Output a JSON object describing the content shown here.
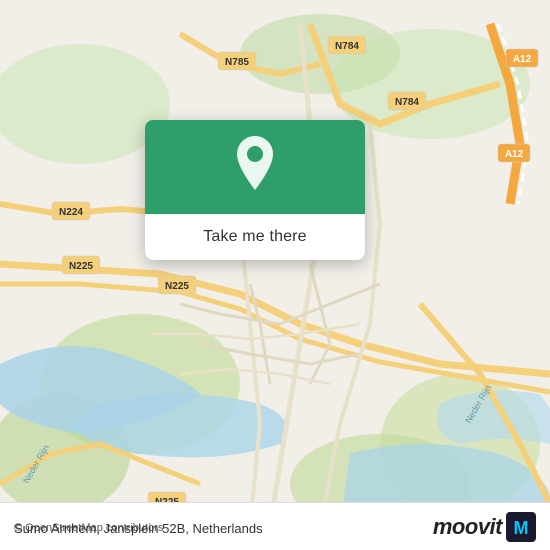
{
  "map": {
    "attribution": "© OpenStreetMap contributors",
    "background_color": "#f2efe9"
  },
  "popup": {
    "button_label": "Take me there",
    "icon_name": "location-pin-icon"
  },
  "bottom_bar": {
    "address": "Sumo Arnhem, Jansplein 52B, Netherlands",
    "logo_text": "moovit"
  }
}
